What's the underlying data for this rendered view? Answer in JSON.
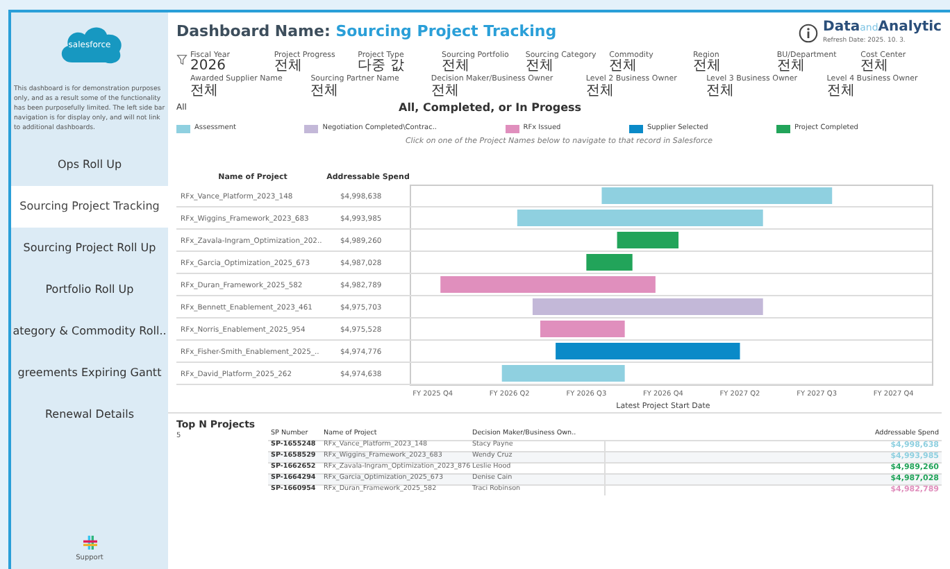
{
  "sidebar": {
    "logo_text": "salesforce",
    "note": "This dashboard is for demonstration purposes only, and as a result some of the functionality has been purposefully limited. The left side bar navigation is for display only, and will not link to additional dashboards.",
    "items": [
      {
        "label": "Ops Roll Up",
        "selected": false
      },
      {
        "label": "Sourcing Project Tracking",
        "selected": true
      },
      {
        "label": "Sourcing Project Roll Up",
        "selected": false
      },
      {
        "label": "Portfolio Roll Up",
        "selected": false
      },
      {
        "label": "ategory & Commodity Roll..",
        "selected": false
      },
      {
        "label": "greements Expiring Gantt",
        "selected": false
      },
      {
        "label": "Renewal Details",
        "selected": false
      }
    ],
    "support": "Support"
  },
  "header": {
    "title_prefix": "Dashboard Name: ",
    "title_name": "Sourcing Project Tracking",
    "brand_a": "Data",
    "brand_b": "and",
    "brand_c": "Analytic",
    "refresh": "Refresh Date: 2025. 10. 3."
  },
  "filters_row_1": [
    {
      "label": "Fiscal Year",
      "value": "2026"
    },
    {
      "label": "Project Progress",
      "value": "전체"
    },
    {
      "label": "Project Type",
      "value": "다중 값"
    },
    {
      "label": "Sourcing Portfolio",
      "value": "전체"
    },
    {
      "label": "Sourcing Category",
      "value": "전체"
    },
    {
      "label": "Commodity",
      "value": "전체"
    },
    {
      "label": "Region",
      "value": "전체"
    },
    {
      "label": "BU/Department",
      "value": "전체"
    },
    {
      "label": "Cost Center",
      "value": "전체"
    }
  ],
  "filters_row_2": [
    {
      "label": "Awarded Supplier Name",
      "value": "전체"
    },
    {
      "label": "Sourcing Partner Name",
      "value": "전체"
    },
    {
      "label": "Decision Maker/Business Owner",
      "value": "전체"
    },
    {
      "label": "Level 2 Business Owner",
      "value": "전체"
    },
    {
      "label": "Level 3 Business Owner",
      "value": "전체"
    },
    {
      "label": "Level 4 Business Owner",
      "value": "전체"
    }
  ],
  "status_filter": "All",
  "chart_title": "All, Completed, or In Progess",
  "legend": [
    {
      "label": "Assessment",
      "color": "#8fd0e0"
    },
    {
      "label": "Negotiation Completed\\Contrac..",
      "color": "#c3b8d8"
    },
    {
      "label": "RFx Issued",
      "color": "#e08fbd"
    },
    {
      "label": "Supplier Selected",
      "color": "#0a8ac8"
    },
    {
      "label": "Project Completed",
      "color": "#22a45a"
    }
  ],
  "hint": "Click on one of the Project Names below to navigate to that record in Salesforce",
  "project_table": {
    "columns": [
      "Name of Project",
      "Addressable Spend"
    ],
    "rows": [
      [
        "RFx_Vance_Platform_2023_148",
        "$4,998,638"
      ],
      [
        "RFx_Wiggins_Framework_2023_683",
        "$4,993,985"
      ],
      [
        "RFx_Zavala-Ingram_Optimization_202..",
        "$4,989,260"
      ],
      [
        "RFx_Garcia_Optimization_2025_673",
        "$4,987,028"
      ],
      [
        "RFx_Duran_Framework_2025_582",
        "$4,982,789"
      ],
      [
        "RFx_Bennett_Enablement_2023_461",
        "$4,975,703"
      ],
      [
        "RFx_Norris_Enablement_2025_954",
        "$4,975,528"
      ],
      [
        "RFx_Fisher-Smith_Enablement_2025_..",
        "$4,974,776"
      ],
      [
        "RFx_David_Platform_2025_262",
        "$4,974,638"
      ]
    ]
  },
  "x_axis": {
    "ticks": [
      "FY 2025 Q4",
      "FY 2026 Q2",
      "FY 2026 Q3",
      "FY 2026 Q4",
      "FY 2027 Q2",
      "FY 2027 Q3",
      "FY 2027 Q4"
    ],
    "title": "Latest Project Start Date"
  },
  "top_n": {
    "title": "Top N Projects",
    "value": "5",
    "columns": [
      "SP Number",
      "Name of Project",
      "Decision Maker/Business Own..",
      "Addressable Spend"
    ],
    "rows": [
      {
        "cells": [
          "SP-1655248",
          "RFx_Vance_Platform_2023_148",
          "Stacy Payne",
          "$4,998,638"
        ],
        "color": "#8fd0e0"
      },
      {
        "cells": [
          "SP-1658529",
          "RFx_Wiggins_Framework_2023_683",
          "Wendy Cruz",
          "$4,993,985"
        ],
        "color": "#8fd0e0"
      },
      {
        "cells": [
          "SP-1662652",
          "RFx_Zavala-Ingram_Optimization_2023_876",
          "Leslie Hood",
          "$4,989,260"
        ],
        "color": "#22a45a"
      },
      {
        "cells": [
          "SP-1664294",
          "RFx_Garcia_Optimization_2025_673",
          "Denise Cain",
          "$4,987,028"
        ],
        "color": "#22a45a"
      },
      {
        "cells": [
          "SP-1660954",
          "RFx_Duran_Framework_2025_582",
          "Traci Robinson",
          "$4,982,789"
        ],
        "color": "#e08fbd"
      }
    ]
  }
}
